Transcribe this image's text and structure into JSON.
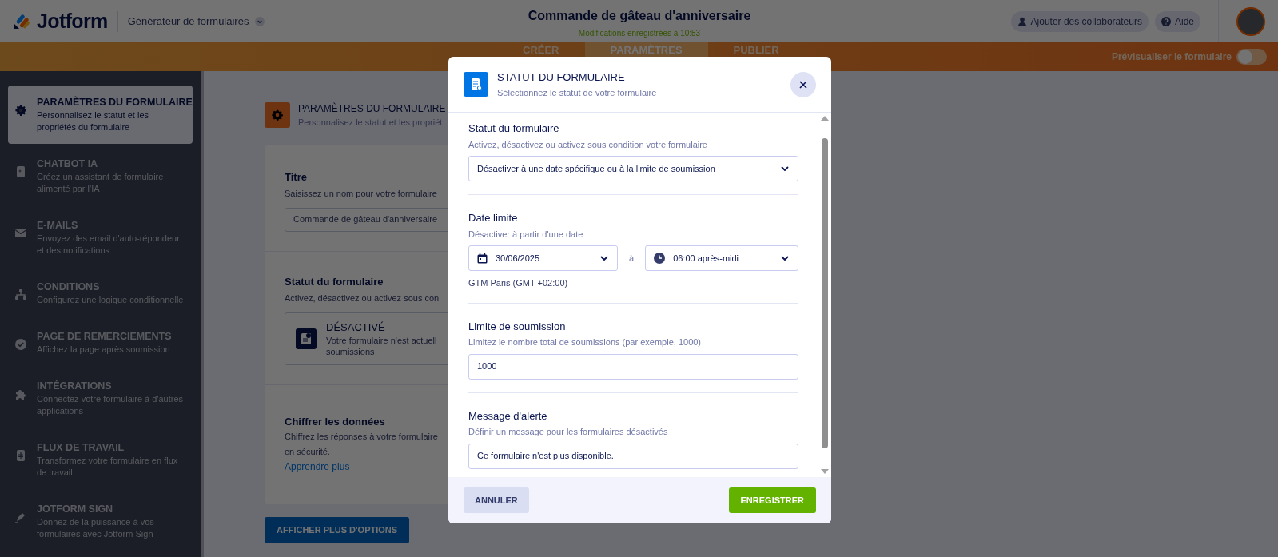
{
  "header": {
    "logo_text": "Jotform",
    "builder_menu": "Générateur de formulaires",
    "form_title": "Commande de gâteau d'anniversaire",
    "save_status": "Modifications enregistrées à 10:53",
    "collaborators_button": "Ajouter des collaborateurs",
    "help_button": "Aide"
  },
  "nav": {
    "tabs": [
      {
        "label": "CRÉER",
        "selected": false
      },
      {
        "label": "PARAMÈTRES",
        "selected": true
      },
      {
        "label": "PUBLIER",
        "selected": false
      }
    ],
    "preview_toggle": {
      "label": "Prévisualiser le formulaire",
      "on": false
    }
  },
  "sidebar": {
    "items": [
      {
        "title": "PARAMÈTRES DU FORMULAIRE",
        "description": "Personnalisez le statut et les propriétés du formulaire",
        "selected": true
      },
      {
        "title": "CHATBOT IA",
        "description": "Créez un assistant de formulaire alimenté par l'IA",
        "selected": false
      },
      {
        "title": "E-MAILS",
        "description": "Envoyez des email d'auto-répondeur et des notifications",
        "selected": false
      },
      {
        "title": "CONDITIONS",
        "description": "Configurez une logique conditionnelle",
        "selected": false
      },
      {
        "title": "PAGE DE REMERCIEMENTS",
        "description": "Affichez la page après soumission",
        "selected": false
      },
      {
        "title": "INTÉGRATIONS",
        "description": "Connectez votre formulaire à d'autres applications",
        "selected": false
      },
      {
        "title": "FLUX DE TRAVAIL",
        "description": "Transformez votre formulaire en flux de travail",
        "selected": false
      },
      {
        "title": "JOTFORM SIGN",
        "description": "Donnez de la puissance à vos formulaires avec Jotform Sign",
        "selected": false
      }
    ]
  },
  "main": {
    "title": "PARAMÈTRES DU FORMULAIRE",
    "subtitle": "Personnalisez le statut et les propriét",
    "title_field": {
      "label": "Titre",
      "hint": "Saisissez un nom pour votre formulaire",
      "value": "Commande de gâteau d'anniversaire"
    },
    "status": {
      "label": "Statut du formulaire",
      "hint": "Activez, désactivez ou activez sous con",
      "option_title": "DÉSACTIVÉ",
      "option_lines": [
        "Votre formulaire n'est actuell",
        "soumissions"
      ]
    },
    "encrypt": {
      "label": "Chiffrer les données",
      "lines": [
        "Chiffrez les réponses à votre formulaire",
        "en sécurité."
      ],
      "link": "Apprendre plus"
    },
    "more_button": "AFFICHER PLUS D'OPTIONS"
  },
  "modal": {
    "title": "STATUT DU FORMULAIRE",
    "subtitle": "Sélectionnez le statut de votre formulaire",
    "status": {
      "label": "Statut du formulaire",
      "hint": "Activez, désactivez ou activez sous condition votre formulaire",
      "value": "Désactiver à une date spécifique ou à la limite de soumission"
    },
    "deadline": {
      "label": "Date limite",
      "hint": "Désactiver à partir d'une date",
      "date": "30/06/2025",
      "separator": "à",
      "time": "06:00 après-midi",
      "timezone": "GTM Paris (GMT +02:00)"
    },
    "limit": {
      "label": "Limite de soumission",
      "hint": "Limitez le nombre total de soumissions (par exemple, 1000)",
      "value": "1000"
    },
    "alert": {
      "label": "Message d'alerte",
      "hint": "Définir un message pour les formulaires désactivés",
      "value": "Ce formulaire n'est plus disponible."
    },
    "cancel_button": "ANNULER",
    "save_button": "ENREGISTRER"
  }
}
